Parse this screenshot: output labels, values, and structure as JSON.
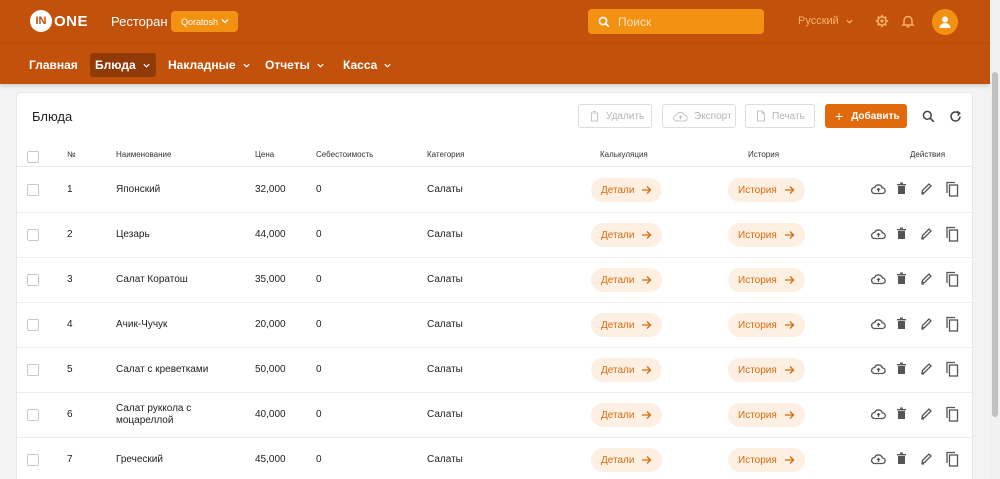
{
  "header": {
    "logo_circle": "IN",
    "logo_text": "ONE",
    "app_title": "Ресторан",
    "org_select": "Qoratosh",
    "search_placeholder": "Поиск",
    "language": "Русский"
  },
  "nav": {
    "items": [
      {
        "label": "Главная",
        "active": false
      },
      {
        "label": "Блюда",
        "active": true
      },
      {
        "label": "Накладные",
        "active": false
      },
      {
        "label": "Отчеты",
        "active": false
      },
      {
        "label": "Касса",
        "active": false
      }
    ]
  },
  "page": {
    "title": "Блюда",
    "delete_label": "Удалить",
    "export_label": "Экспорт",
    "print_label": "Печать",
    "add_label": "Добавить"
  },
  "table": {
    "headers": {
      "num": "№",
      "name": "Наименование",
      "price": "Цена",
      "cost": "Себестоимость",
      "category": "Категория",
      "calc": "Калькуляция",
      "history": "История",
      "actions": "Действия"
    },
    "details_label": "Детали",
    "history_label": "История",
    "rows": [
      {
        "num": "1",
        "name_line1": "Японский",
        "name_line2": "",
        "price": "32,000",
        "cost": "0",
        "category": "Салаты"
      },
      {
        "num": "2",
        "name_line1": "Цезарь",
        "name_line2": "",
        "price": "44,000",
        "cost": "0",
        "category": "Салаты"
      },
      {
        "num": "3",
        "name_line1": "Салат Коратош",
        "name_line2": "",
        "price": "35,000",
        "cost": "0",
        "category": "Салаты"
      },
      {
        "num": "4",
        "name_line1": "Ачик-Чучук",
        "name_line2": "",
        "price": "20,000",
        "cost": "0",
        "category": "Салаты"
      },
      {
        "num": "5",
        "name_line1": "Салат с креветками",
        "name_line2": "",
        "price": "50,000",
        "cost": "0",
        "category": "Салаты"
      },
      {
        "num": "6",
        "name_line1": "Салат руккола с",
        "name_line2": "моцареллой",
        "price": "40,000",
        "cost": "0",
        "category": "Салаты"
      },
      {
        "num": "7",
        "name_line1": "Греческий",
        "name_line2": "",
        "price": "45,000",
        "cost": "0",
        "category": "Салаты"
      }
    ]
  },
  "colors": {
    "brand": "#c2510b",
    "accent": "#f39212",
    "add_button": "#e06a0c",
    "pill_bg": "#fdf0e2",
    "pill_text": "#d86a0c"
  }
}
